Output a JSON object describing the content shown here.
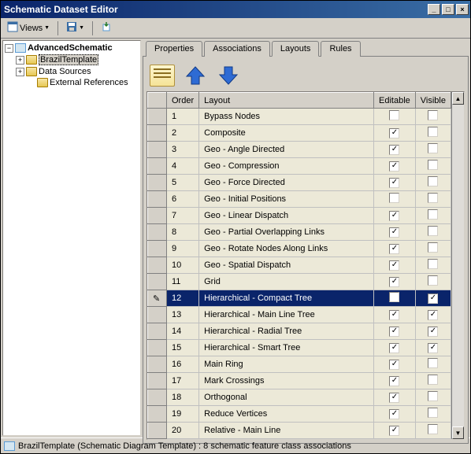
{
  "window": {
    "title": "Schematic Dataset Editor"
  },
  "toolbar": {
    "views_label": "Views"
  },
  "tree": {
    "root": "AdvancedSchematic",
    "items": [
      {
        "label": "BrazilTemplate"
      },
      {
        "label": "Data Sources"
      },
      {
        "label": "External References"
      }
    ]
  },
  "tabs": {
    "items": [
      "Properties",
      "Associations",
      "Layouts",
      "Rules"
    ],
    "active": "Layouts"
  },
  "grid": {
    "headers": {
      "order": "Order",
      "layout": "Layout",
      "editable": "Editable",
      "visible": "Visible"
    },
    "rows": [
      {
        "order": "1",
        "layout": "Bypass Nodes",
        "editable": false,
        "visible": false,
        "selected": false
      },
      {
        "order": "2",
        "layout": "Composite",
        "editable": true,
        "visible": false,
        "selected": false
      },
      {
        "order": "3",
        "layout": "Geo - Angle Directed",
        "editable": true,
        "visible": false,
        "selected": false
      },
      {
        "order": "4",
        "layout": "Geo - Compression",
        "editable": true,
        "visible": false,
        "selected": false
      },
      {
        "order": "5",
        "layout": "Geo - Force Directed",
        "editable": true,
        "visible": false,
        "selected": false
      },
      {
        "order": "6",
        "layout": "Geo - Initial Positions",
        "editable": false,
        "visible": false,
        "selected": false
      },
      {
        "order": "7",
        "layout": "Geo - Linear Dispatch",
        "editable": true,
        "visible": false,
        "selected": false
      },
      {
        "order": "8",
        "layout": "Geo - Partial Overlapping Links",
        "editable": true,
        "visible": false,
        "selected": false
      },
      {
        "order": "9",
        "layout": "Geo - Rotate Nodes Along Links",
        "editable": true,
        "visible": false,
        "selected": false
      },
      {
        "order": "10",
        "layout": "Geo - Spatial Dispatch",
        "editable": true,
        "visible": false,
        "selected": false
      },
      {
        "order": "11",
        "layout": "Grid",
        "editable": true,
        "visible": false,
        "selected": false
      },
      {
        "order": "12",
        "layout": "Hierarchical - Compact Tree",
        "editable": false,
        "visible": true,
        "selected": true
      },
      {
        "order": "13",
        "layout": "Hierarchical - Main Line Tree",
        "editable": true,
        "visible": true,
        "selected": false
      },
      {
        "order": "14",
        "layout": "Hierarchical - Radial Tree",
        "editable": true,
        "visible": true,
        "selected": false
      },
      {
        "order": "15",
        "layout": "Hierarchical - Smart Tree",
        "editable": true,
        "visible": true,
        "selected": false
      },
      {
        "order": "16",
        "layout": "Main Ring",
        "editable": true,
        "visible": false,
        "selected": false
      },
      {
        "order": "17",
        "layout": "Mark Crossings",
        "editable": true,
        "visible": false,
        "selected": false
      },
      {
        "order": "18",
        "layout": "Orthogonal",
        "editable": true,
        "visible": false,
        "selected": false
      },
      {
        "order": "19",
        "layout": "Reduce Vertices",
        "editable": true,
        "visible": false,
        "selected": false
      },
      {
        "order": "20",
        "layout": "Relative - Main Line",
        "editable": true,
        "visible": false,
        "selected": false
      }
    ]
  },
  "status": {
    "text": "BrazilTemplate (Schematic Diagram Template) : 8 schematic feature class associations"
  }
}
